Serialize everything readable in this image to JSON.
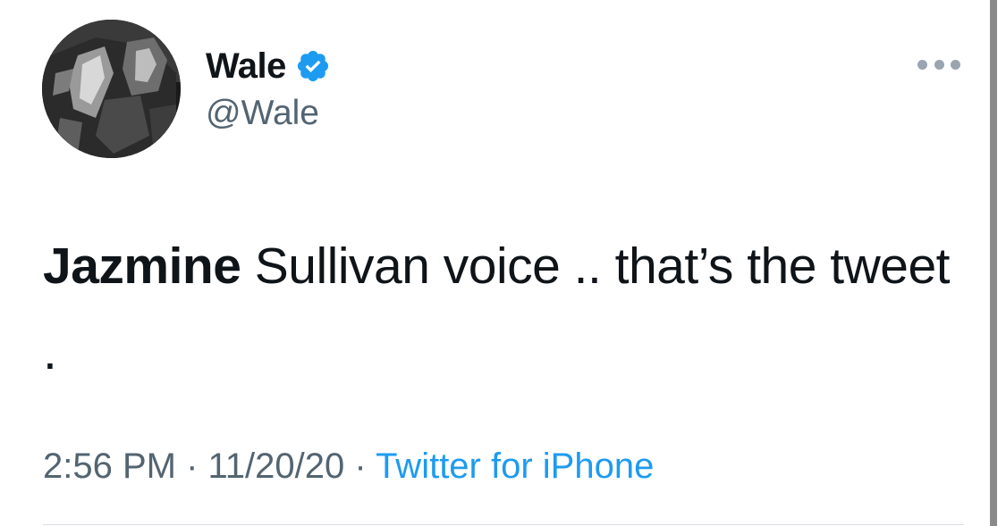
{
  "author": {
    "name": "Wale",
    "handle": "@Wale",
    "verified": true,
    "verified_color": "#1d9bf0"
  },
  "more_button": {
    "icon": "more-horizontal-icon"
  },
  "tweet": {
    "text_bold": "Jazmine",
    "text_rest": " Sullivan voice .. that’s the tweet ."
  },
  "meta": {
    "time": "2:56 PM",
    "sep1": " · ",
    "date": "11/20/20",
    "sep2": " · ",
    "source": "Twitter for iPhone"
  },
  "colors": {
    "text": "#0f1419",
    "secondary": "#536471",
    "link": "#1d9bf0"
  }
}
